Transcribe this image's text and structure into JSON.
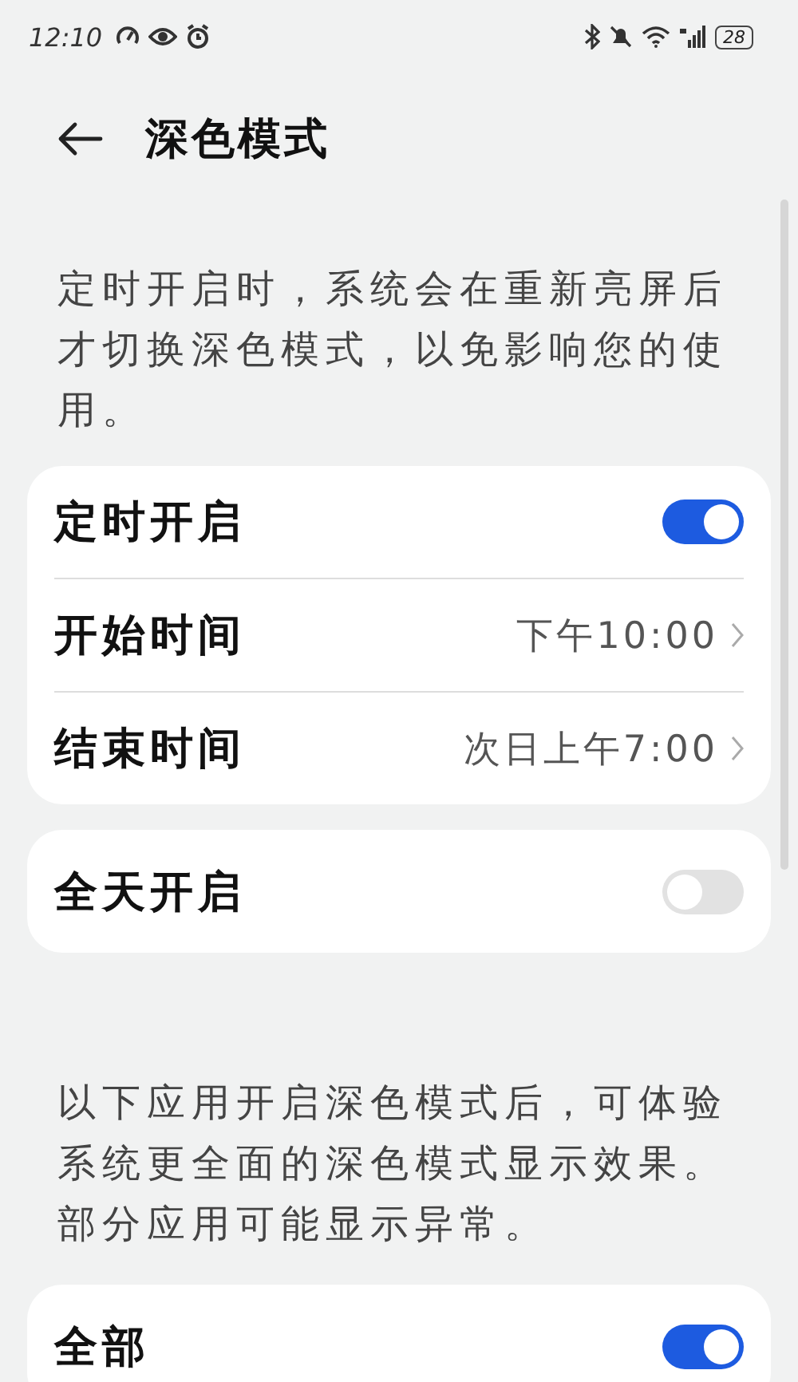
{
  "status_bar": {
    "time": "12:10",
    "battery": "28"
  },
  "header": {
    "title": "深色模式"
  },
  "note_1": "定时开启时，系统会在重新亮屏后才切换深色模式，以免影响您的使用。",
  "card_1": [
    {
      "kind": "toggle",
      "label": "定时开启",
      "on": true
    },
    {
      "kind": "value",
      "label": "开始时间",
      "value": "下午10:00"
    },
    {
      "kind": "value",
      "label": "结束时间",
      "value": "次日上午7:00"
    }
  ],
  "card_2": [
    {
      "kind": "toggle",
      "label": "全天开启",
      "on": false
    }
  ],
  "note_2": "以下应用开启深色模式后，可体验系统更全面的深色模式显示效果。部分应用可能显示异常。",
  "card_3": [
    {
      "kind": "toggle",
      "label": "全部",
      "on": true
    }
  ]
}
